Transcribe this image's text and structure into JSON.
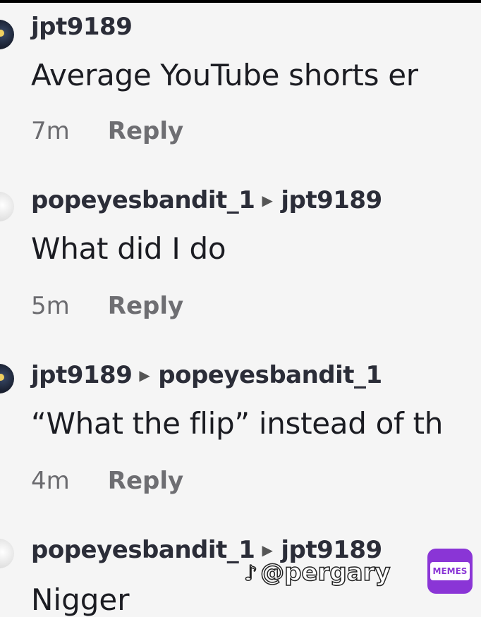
{
  "comments": [
    {
      "author": "jpt9189",
      "reply_to": "",
      "text": "Average YouTube shorts er",
      "time": "7m",
      "reply_label": "Reply"
    },
    {
      "author": "popeyesbandit_1",
      "reply_to": "jpt9189",
      "text": "What did I do",
      "time": "5m",
      "reply_label": "Reply"
    },
    {
      "author": "jpt9189",
      "reply_to": "popeyesbandit_1",
      "text": "“What the flip” instead of th",
      "time": "4m",
      "reply_label": "Reply"
    },
    {
      "author": "popeyesbandit_1",
      "reply_to": "jpt9189",
      "text": "Nigger"
    }
  ],
  "watermark": {
    "handle": "@pergary"
  },
  "badge": {
    "label": "MEMES"
  }
}
